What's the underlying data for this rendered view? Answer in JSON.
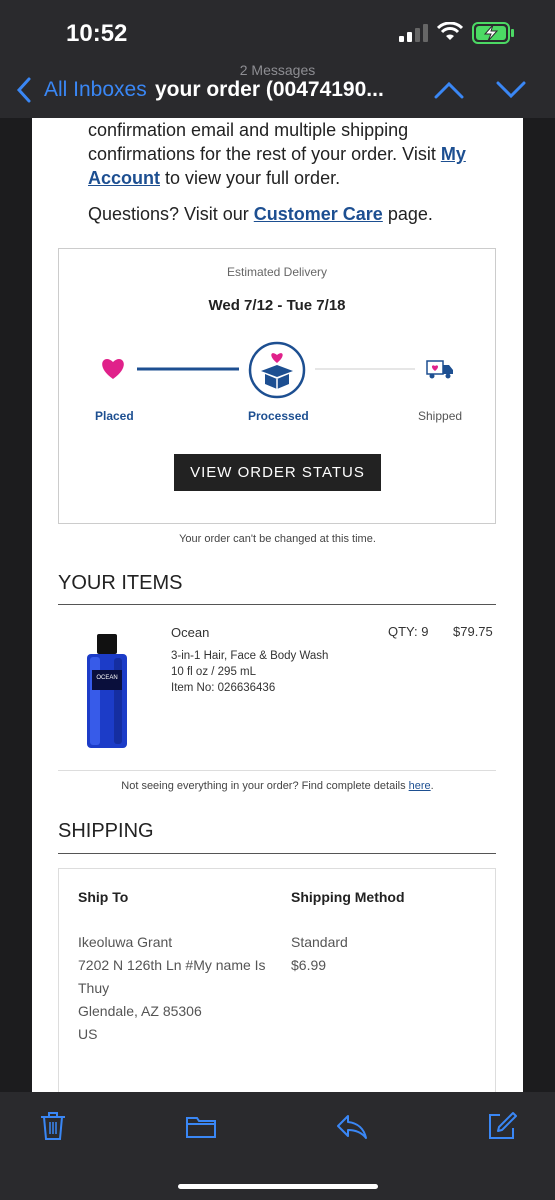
{
  "status": {
    "time": "10:52"
  },
  "nav": {
    "messages_count": "2 Messages",
    "back_label": "All Inboxes",
    "subject": "your order (00474190..."
  },
  "email": {
    "intro_line1": "confirmation email and multiple shipping",
    "intro_line2a": "confirmations for the rest of your order. Visit ",
    "intro_link_myaccount_1": "My",
    "intro_link_myaccount_2": "Account",
    "intro_line3b": " to view your full order.",
    "questions_prefix": "Questions? Visit our ",
    "questions_link": "Customer Care",
    "questions_suffix": " page.",
    "delivery": {
      "label": "Estimated Delivery",
      "dates": "Wed 7/12 - Tue 7/18",
      "steps": [
        "Placed",
        "Processed",
        "Shipped"
      ],
      "button": "VIEW ORDER STATUS"
    },
    "cannot_change_note": "Your order can't be changed at this time.",
    "items_title": "YOUR ITEMS",
    "item": {
      "name": "Ocean",
      "qty": "QTY: 9",
      "price": "$79.75",
      "desc1": "3-in-1 Hair, Face & Body Wash",
      "desc2": "10 fl oz / 295 mL",
      "desc3": "Item No: 026636436",
      "bottle_label": "OCEAN"
    },
    "details_note_prefix": "Not seeing everything in your order? Find complete details ",
    "details_note_link": "here",
    "details_note_suffix": ".",
    "shipping_title": "SHIPPING",
    "ship_to_label": "Ship To",
    "ship_method_label": "Shipping Method",
    "address": [
      "Ikeoluwa Grant",
      "7202 N 126th Ln #My name Is",
      "Thuy",
      "Glendale, AZ 85306",
      "US"
    ],
    "method": "Standard",
    "method_price": "$6.99"
  },
  "colors": {
    "accent": "#1d4f91",
    "heart": "#e0218a",
    "ios_blue": "#3a87f5"
  },
  "icons": [
    "back-chevron-icon",
    "up-chevron-icon",
    "down-chevron-icon",
    "heart-icon",
    "box-heart-icon",
    "truck-icon",
    "trash-icon",
    "folder-icon",
    "reply-icon",
    "compose-icon"
  ]
}
